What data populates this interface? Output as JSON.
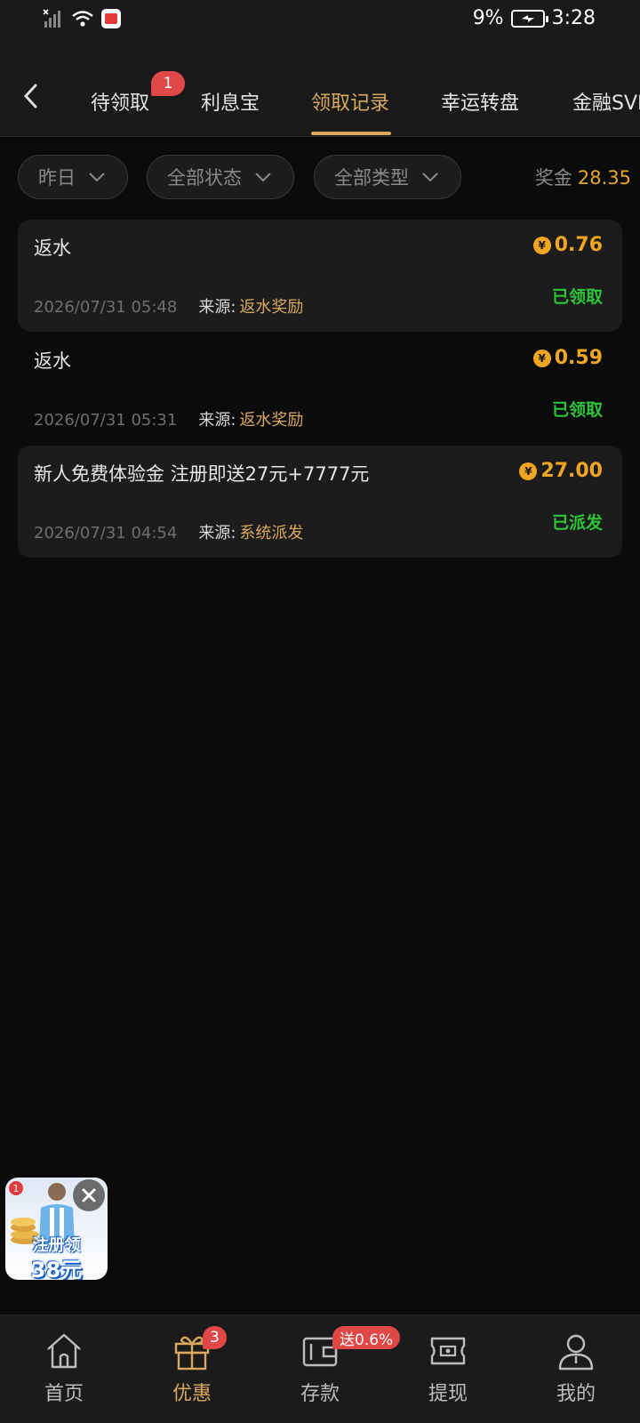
{
  "status_bar": {
    "battery": "9%",
    "time": "3:28"
  },
  "tabs": [
    {
      "label": "待领取",
      "badge": "1"
    },
    {
      "label": "利息宝"
    },
    {
      "label": "领取记录",
      "active": true
    },
    {
      "label": "幸运转盘"
    },
    {
      "label": "金融SVIP"
    }
  ],
  "filters": {
    "date": "昨日",
    "status": "全部状态",
    "type": "全部类型",
    "bonus_label": "奖金",
    "bonus_value": "28.35"
  },
  "records": [
    {
      "title": "返水",
      "amount": "0.76",
      "status": "已领取",
      "time": "2026/07/31 05:48",
      "source_label": "来源:",
      "source": "返水奖励"
    },
    {
      "title": "返水",
      "amount": "0.59",
      "status": "已领取",
      "time": "2026/07/31 05:31",
      "source_label": "来源:",
      "source": "返水奖励"
    },
    {
      "title": "新人免费体验金 注册即送27元+7777元",
      "amount": "27.00",
      "status": "已派发",
      "time": "2026/07/31 04:54",
      "source_label": "来源:",
      "source": "系统派发"
    }
  ],
  "promo": {
    "badge": "1",
    "line1": "注册领",
    "line2": "38元"
  },
  "bottom_nav": [
    {
      "label": "首页",
      "icon": "home-icon"
    },
    {
      "label": "优惠",
      "icon": "gift-icon",
      "badge": "3",
      "active": true
    },
    {
      "label": "存款",
      "icon": "wallet-icon",
      "badge": "送0.6%"
    },
    {
      "label": "提现",
      "icon": "ticket-icon"
    },
    {
      "label": "我的",
      "icon": "user-icon"
    }
  ],
  "colors": {
    "accent_gold": "#d8a85e",
    "amount_orange": "#f0a623",
    "status_green": "#2ec43a",
    "badge_red": "#e04848",
    "background": "#0b0b0b",
    "card": "#1c1c1c"
  }
}
